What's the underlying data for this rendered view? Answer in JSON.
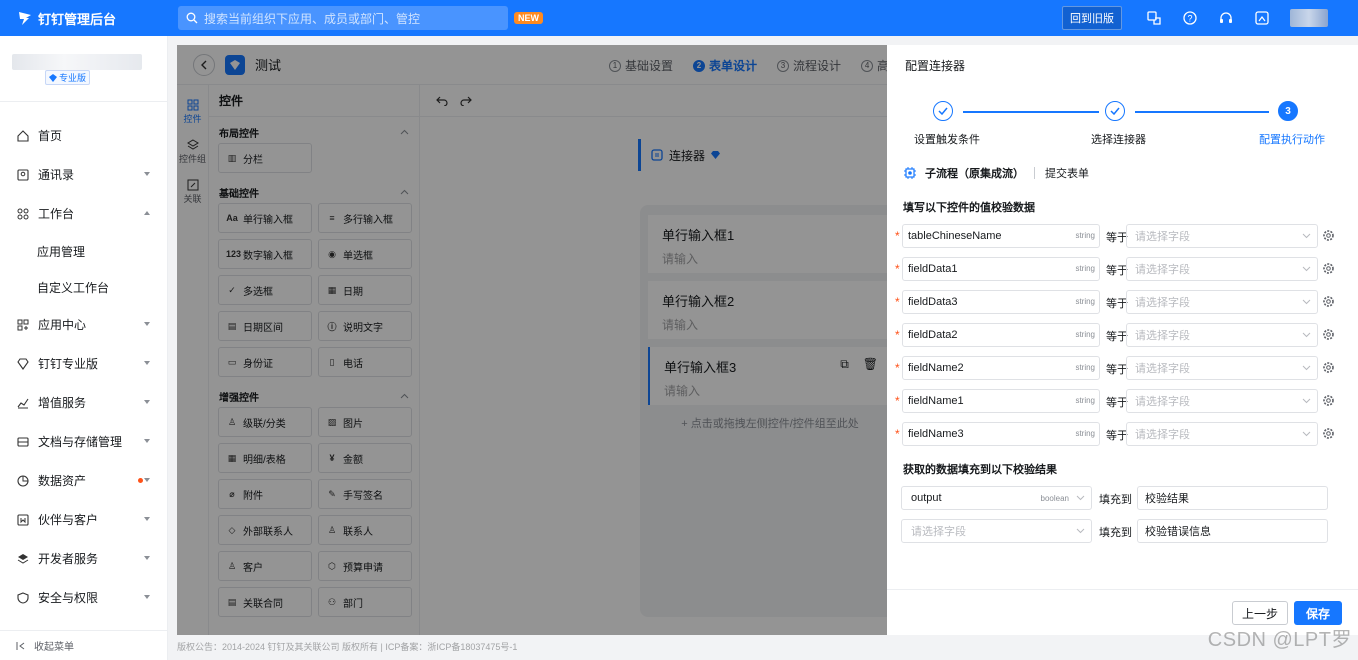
{
  "topbar": {
    "logo": "钉钉管理后台",
    "search_placeholder": "搜索当前组织下应用、成员或部门、管控",
    "new_badge": "NEW",
    "old_version": "回到旧版"
  },
  "sidebar": {
    "edition": "专业版",
    "items": [
      {
        "label": "首页"
      },
      {
        "label": "通讯录"
      },
      {
        "label": "工作台"
      },
      {
        "label": "应用管理"
      },
      {
        "label": "自定义工作台"
      },
      {
        "label": "应用中心"
      },
      {
        "label": "钉钉专业版"
      },
      {
        "label": "增值服务"
      },
      {
        "label": "文档与存储管理"
      },
      {
        "label": "数据资产"
      },
      {
        "label": "伙伴与客户"
      },
      {
        "label": "开发者服务"
      },
      {
        "label": "安全与权限"
      }
    ],
    "collapse": "收起菜单"
  },
  "editor": {
    "title": "测试",
    "steps": [
      {
        "num": "1",
        "label": "基础设置"
      },
      {
        "num": "2",
        "label": "表单设计"
      },
      {
        "num": "3",
        "label": "流程设计"
      },
      {
        "num": "4",
        "label": "高"
      }
    ],
    "rail": [
      "控件",
      "控件组",
      "关联"
    ],
    "palette_title": "控件",
    "groups": [
      {
        "title": "布局控件",
        "items": [
          "分栏"
        ]
      },
      {
        "title": "基础控件",
        "items": [
          "单行输入框",
          "多行输入框",
          "数字输入框",
          "单选框",
          "多选框",
          "日期",
          "日期区间",
          "说明文字",
          "身份证",
          "电话"
        ]
      },
      {
        "title": "增强控件",
        "items": [
          "级联/分类",
          "图片",
          "明细/表格",
          "金额",
          "附件",
          "手写签名",
          "外部联系人",
          "联系人",
          "客户",
          "预算申请",
          "关联合同",
          "部门"
        ]
      }
    ],
    "connector": "连接器",
    "fields": [
      {
        "label": "单行输入框1",
        "placeholder": "请输入"
      },
      {
        "label": "单行输入框2",
        "placeholder": "请输入"
      },
      {
        "label": "单行输入框3",
        "placeholder": "请输入"
      }
    ],
    "dropzone": "+ 点击或拖拽左侧控件/控件组至此处"
  },
  "drawer": {
    "title": "配置连接器",
    "wizard": [
      "设置触发条件",
      "选择连接器",
      "配置执行动作"
    ],
    "wizard_current": "3",
    "subprocess": "子流程（原集成流）",
    "submit_form": "提交表单",
    "section1": "填写以下控件的值校验数据",
    "equals": "等于",
    "select_placeholder": "请选择字段",
    "params": [
      {
        "name": "tableChineseName",
        "type": "string"
      },
      {
        "name": "fieldData1",
        "type": "string"
      },
      {
        "name": "fieldData3",
        "type": "string"
      },
      {
        "name": "fieldData2",
        "type": "string"
      },
      {
        "name": "fieldName2",
        "type": "string"
      },
      {
        "name": "fieldName1",
        "type": "string"
      },
      {
        "name": "fieldName3",
        "type": "string"
      }
    ],
    "section2": "获取的数据填充到以下校验结果",
    "fill_to": "填充到",
    "outputs": [
      {
        "name": "output",
        "type": "boolean",
        "target": "校验结果"
      },
      {
        "name": "请选择字段",
        "type": "",
        "target": "校验错误信息"
      }
    ],
    "prev": "上一步",
    "save": "保存"
  },
  "footer": "版权公告：2014-2024 钉钉及其关联公司 版权所有 | ICP备案：浙ICP备18037475号-1",
  "watermark": "CSDN @LPT罗",
  "colors": {
    "brand": "#1677ff",
    "required": "#ff5219"
  }
}
